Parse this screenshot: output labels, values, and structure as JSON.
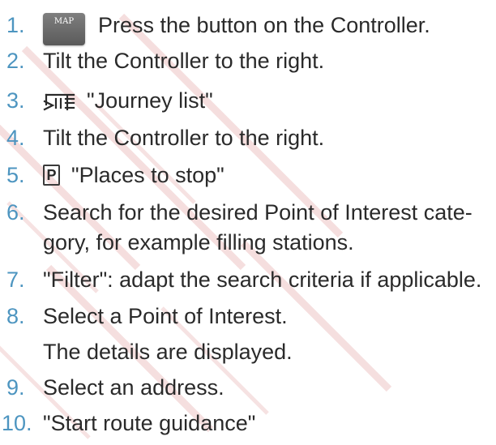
{
  "steps": [
    {
      "number": "1.",
      "text": "Press the button on the Controller.",
      "button_label": "MAP"
    },
    {
      "number": "2.",
      "text": "Tilt the Controller to the right."
    },
    {
      "number": "3.",
      "text": "\"Journey list\"",
      "icon": "journey-list-icon"
    },
    {
      "number": "4.",
      "text": "Tilt the Controller to the right."
    },
    {
      "number": "5.",
      "text": "\"Places to stop\"",
      "icon_label": "P"
    },
    {
      "number": "6.",
      "text": "Search for the desired Point of Interest cate-",
      "text_line2": "gory, for example filling stations."
    },
    {
      "number": "7.",
      "text": "\"Filter\": adapt the search criteria if applicable."
    },
    {
      "number": "8.",
      "text": "Select a Point of Interest.",
      "note": "The details are displayed."
    },
    {
      "number": "9.",
      "text": "Select an address."
    },
    {
      "number": "10.",
      "text": "\"Start route guidance\""
    }
  ],
  "colors": {
    "number": "#4d95c0",
    "text": "#2a2a2a",
    "watermark": "#e8b4b4"
  }
}
